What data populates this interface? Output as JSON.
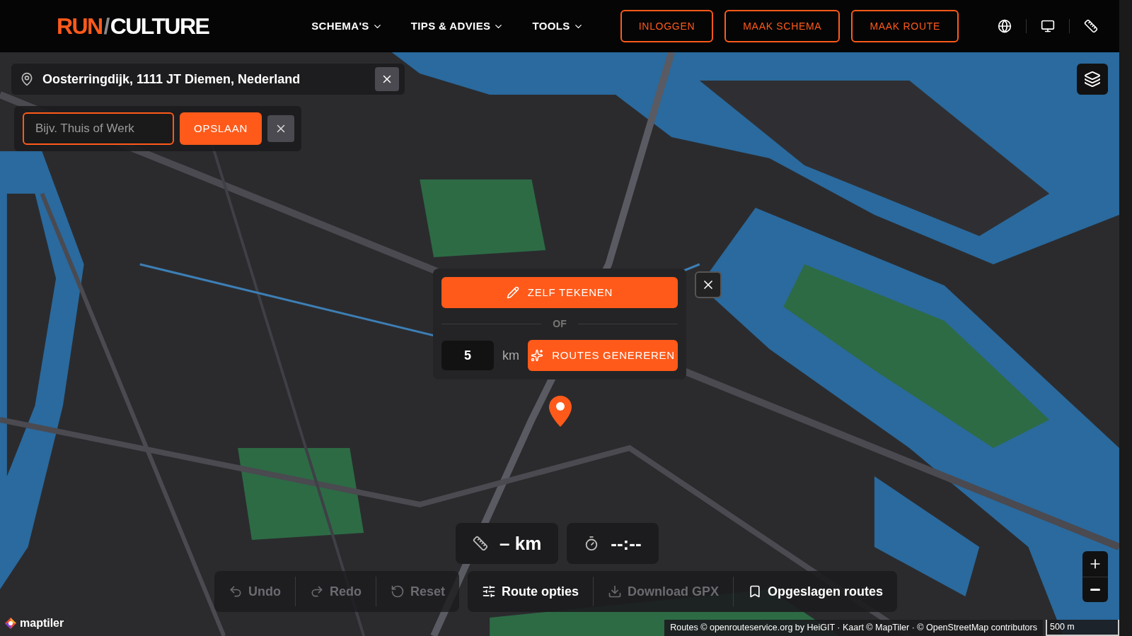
{
  "header": {
    "logo": {
      "part_1": "RUN",
      "separator": "/",
      "part_2": "CULTURE"
    },
    "nav": [
      {
        "label": "SCHEMA'S"
      },
      {
        "label": "TIPS & ADVIES"
      },
      {
        "label": "TOOLS"
      }
    ],
    "buttons": [
      "INLOGGEN",
      "MAAK SCHEMA",
      "MAAK ROUTE"
    ]
  },
  "location": {
    "address": "Oosterringdijk, 1111 JT Diemen, Nederland"
  },
  "save_place": {
    "placeholder": "Bijv. Thuis of Werk",
    "button": "OPSLAAN"
  },
  "route_popup": {
    "draw_button": "ZELF TEKENEN",
    "divider": "OF",
    "distance": "5",
    "unit": "km",
    "generate_button": "ROUTES GENEREREN"
  },
  "stats": [
    {
      "kind": "distance",
      "value": "– km"
    },
    {
      "kind": "time",
      "value": "--:--"
    }
  ],
  "toolbar": {
    "history": [
      {
        "kind": "undo",
        "label": "Undo",
        "disabled": true
      },
      {
        "kind": "redo",
        "label": "Redo",
        "disabled": true
      },
      {
        "kind": "reset",
        "label": "Reset",
        "disabled": true
      }
    ],
    "actions": [
      {
        "kind": "options",
        "label": "Route opties",
        "disabled": false
      },
      {
        "kind": "download",
        "label": "Download GPX",
        "disabled": true
      },
      {
        "kind": "saved",
        "label": "Opgeslagen routes",
        "disabled": false
      }
    ]
  },
  "map": {
    "brand": "maptiler",
    "attribution": "Routes © openrouteservice.org by HeiGIT · Kaart © MapTiler · © OpenStreetMap contributors",
    "scale": "500 m"
  }
}
